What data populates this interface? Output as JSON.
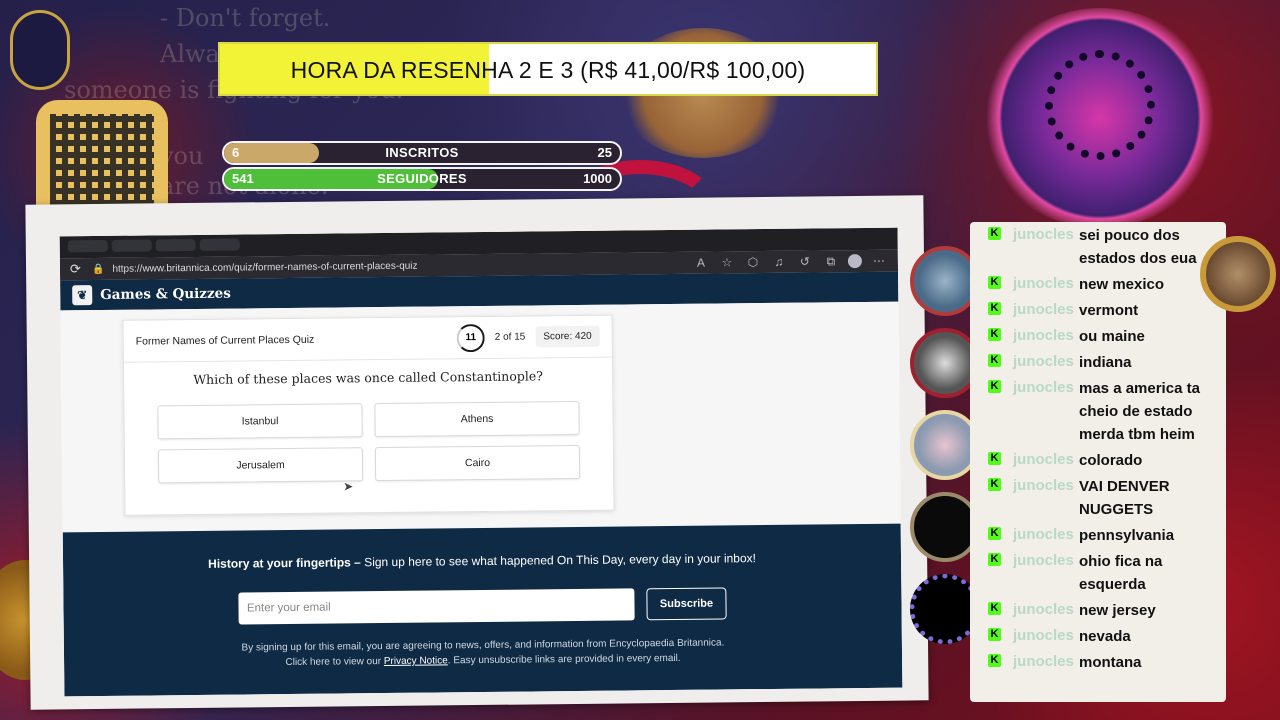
{
  "overlay": {
    "goal_text": "HORA DA RESENHA 2 E 3 (R$ 41,00/R$ 100,00)",
    "goal_progress": 0.41,
    "bg_quotes": [
      "- Don't forget.",
      "Always,",
      "someone is fighting for you.",
      "you",
      "are not alone."
    ],
    "counters": [
      {
        "current": "6",
        "label": "INSCRITOS",
        "max": "25",
        "progress": 0.24,
        "color": "#c9a86a"
      },
      {
        "current": "541",
        "label": "SEGUIDORES",
        "max": "1000",
        "progress": 0.54,
        "color": "#4fbf3a"
      }
    ]
  },
  "browser": {
    "url": "https://www.britannica.com/quiz/former-names-of-current-places-quiz",
    "site_title": "Games & Quizzes"
  },
  "quiz": {
    "title": "Former Names of Current Places Quiz",
    "timer": "11",
    "progress": "2 of 15",
    "score": "Score: 420",
    "question": "Which of these places was once called Constantinople?",
    "answers": [
      "Istanbul",
      "Athens",
      "Jerusalem",
      "Cairo"
    ]
  },
  "newsletter": {
    "heading_bold": "History at your fingertips –",
    "heading_rest": " Sign up here to see what happened On This Day, every day in your inbox!",
    "email_placeholder": "Enter your email",
    "subscribe_label": "Subscribe",
    "legal_line1": "By signing up for this email, you are agreeing to news, offers, and information from Encyclopaedia Britannica.",
    "legal_pre": "Click here to view our ",
    "legal_link": "Privacy Notice",
    "legal_post": ". Easy unsubscribe links are provided in every email."
  },
  "chat": {
    "username": "junocles",
    "messages": [
      "sei pouco dos estados dos eua",
      "new mexico",
      "vermont",
      "ou maine",
      "indiana",
      "mas a america ta cheio de estado merda tbm heim",
      "colorado",
      "VAI DENVER NUGGETS",
      "pennsylvania",
      "ohio fica na esquerda",
      "new jersey",
      "nevada",
      "montana"
    ]
  }
}
